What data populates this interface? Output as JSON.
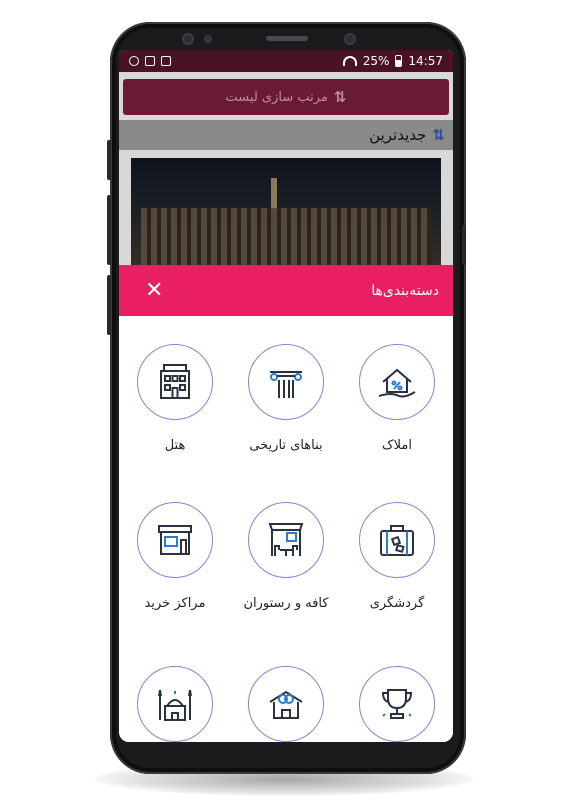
{
  "status_bar": {
    "battery": "25%",
    "time": "14:57"
  },
  "sort_button": {
    "label": "مرتب سازی لیست",
    "icon": "sort-icon"
  },
  "sort_heading": {
    "label": "جدیدترین",
    "icon": "sort-icon"
  },
  "sheet": {
    "title": "دسته‌بندی‌ها",
    "close_icon": "close-icon"
  },
  "categories": [
    {
      "label": "املاک",
      "icon": "house-icon"
    },
    {
      "label": "بناهای تاریخی",
      "icon": "column-icon"
    },
    {
      "label": "هتل",
      "icon": "hotel-icon"
    },
    {
      "label": "گردشگری",
      "icon": "suitcase-icon"
    },
    {
      "label": "کافه و رستوران",
      "icon": "cafe-icon"
    },
    {
      "label": "مراکز خرید",
      "icon": "shop-icon"
    },
    {
      "label": "",
      "icon": "trophy-icon"
    },
    {
      "label": "",
      "icon": "rings-icon"
    },
    {
      "label": "",
      "icon": "mosque-icon"
    }
  ],
  "colors": {
    "accent": "#e91e63",
    "dark": "#4b1226",
    "circle_border": "#7a8bd4",
    "icon_blue": "#2e7bd6"
  }
}
